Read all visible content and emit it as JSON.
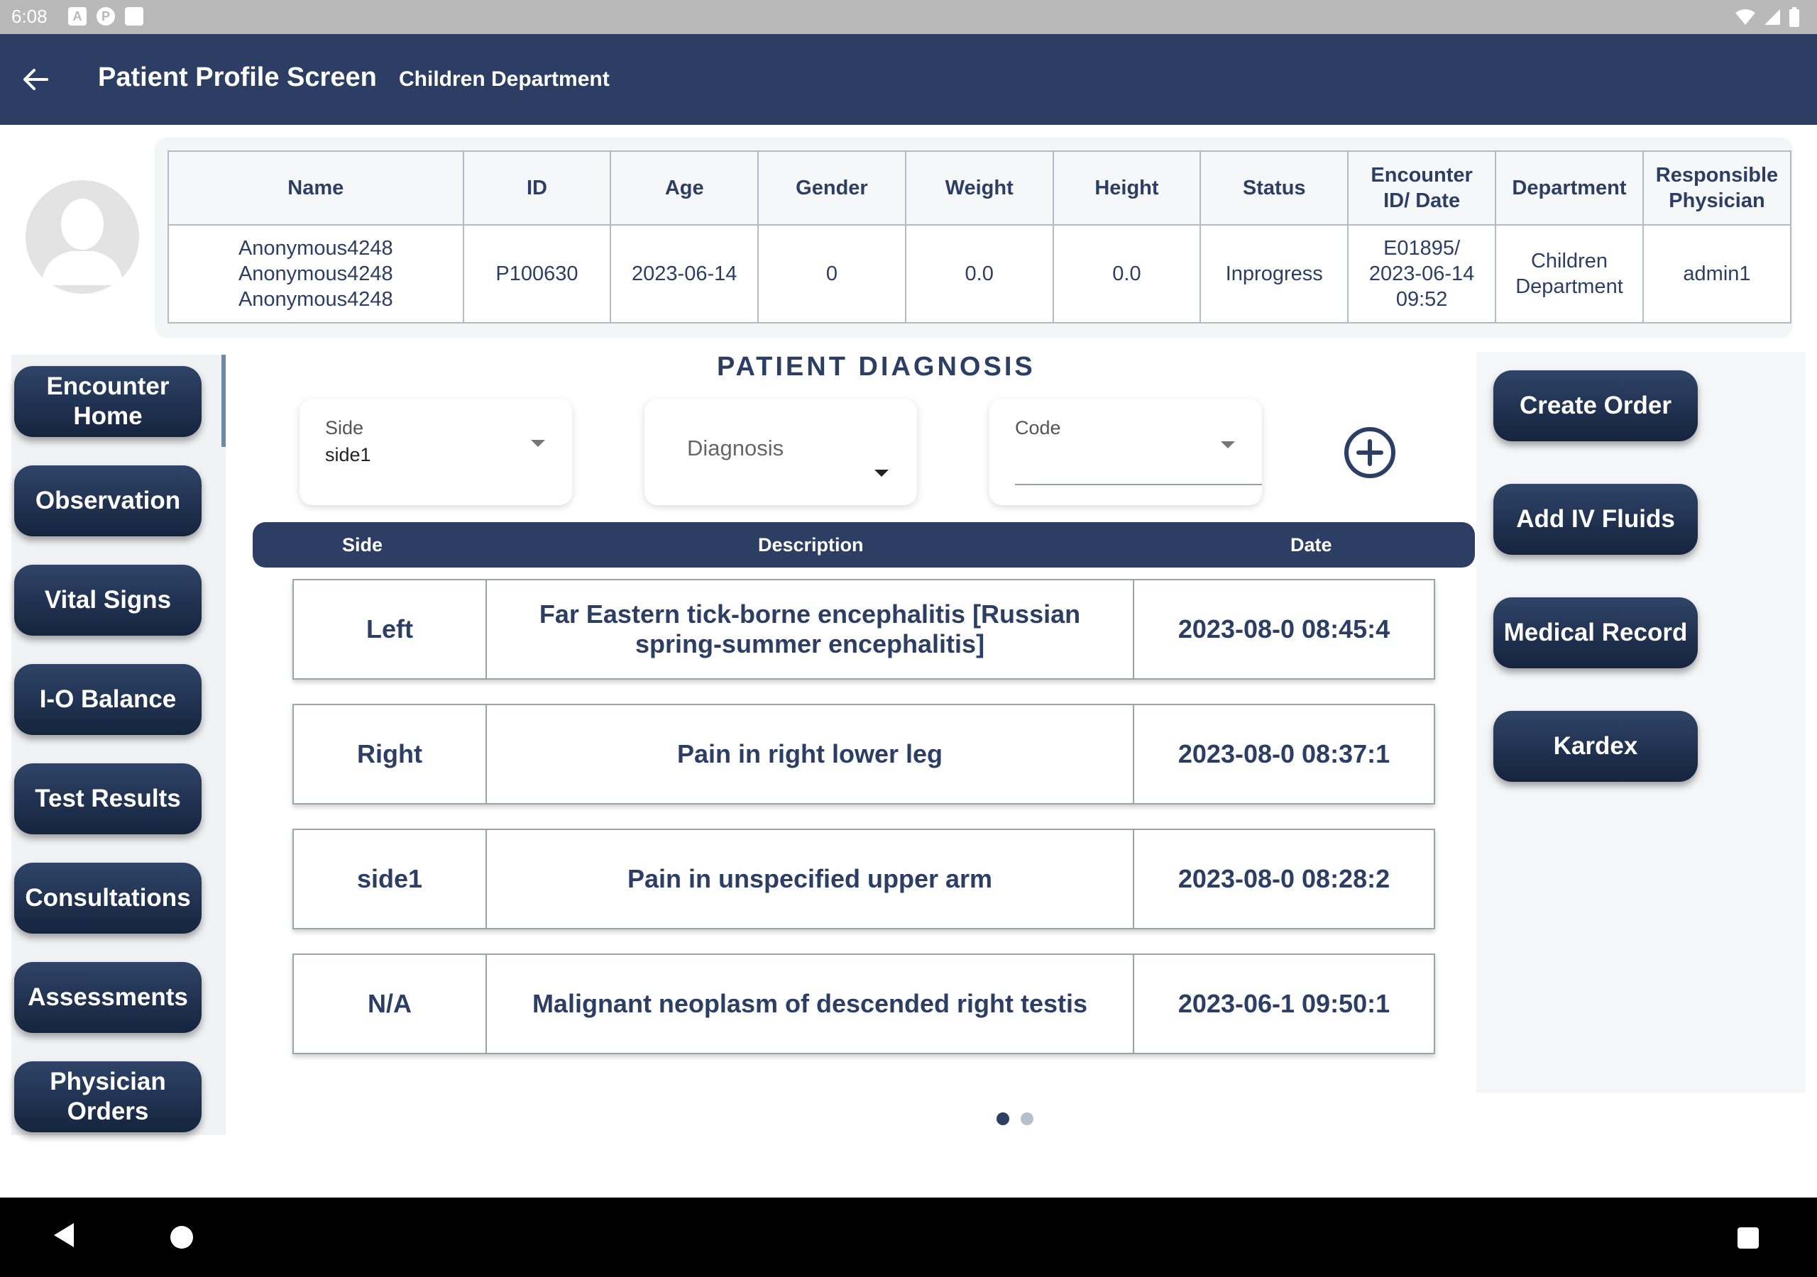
{
  "status_bar": {
    "time": "6:08",
    "icons": [
      "a-icon",
      "p-icon",
      "sd-card-icon"
    ],
    "right_icons": [
      "wifi-icon",
      "signal-icon",
      "battery-icon"
    ]
  },
  "app_bar": {
    "back_icon": "arrow-back-icon",
    "title": "Patient Profile Screen",
    "subtitle": "Children Department"
  },
  "patient_info": {
    "headers": [
      "Name",
      "ID",
      "Age",
      "Gender",
      "Weight",
      "Height",
      "Status",
      "Encounter ID/ Date",
      "Department",
      "Responsible Physician"
    ],
    "values": {
      "name": [
        "Anonymous4248",
        "Anonymous4248",
        "Anonymous4248"
      ],
      "id": "P100630",
      "age": "2023-06-14",
      "gender": "0",
      "weight": "0.0",
      "height": "0.0",
      "status": "Inprogress",
      "encounter": [
        "E01895/",
        "2023-06-14",
        "09:52"
      ],
      "department": [
        "Children",
        "Department"
      ],
      "physician": "admin1"
    }
  },
  "left_nav": {
    "items": [
      {
        "label": "Encounter Home",
        "active": true
      },
      {
        "label": "Observation"
      },
      {
        "label": "Vital Signs"
      },
      {
        "label": "I-O Balance"
      },
      {
        "label": "Test Results"
      },
      {
        "label": "Consultations"
      },
      {
        "label": "Assessments"
      },
      {
        "label": "Physician Orders"
      }
    ]
  },
  "diagnosis": {
    "title": "PATIENT DIAGNOSIS",
    "side_field": {
      "label": "Side",
      "value": "side1"
    },
    "diagnosis_field": {
      "placeholder": "Diagnosis"
    },
    "code_field": {
      "label": "Code",
      "value": ""
    },
    "add_icon": "plus-circle-icon",
    "columns": [
      "Side",
      "Description",
      "Date"
    ],
    "rows": [
      {
        "side": "Left",
        "description": "Far Eastern tick-borne encephalitis [Russian spring-summer encephalitis]",
        "date": "2023-08-0 08:45:4"
      },
      {
        "side": "Right",
        "description": "Pain in right lower leg",
        "date": "2023-08-0 08:37:1"
      },
      {
        "side": "side1",
        "description": "Pain in unspecified upper arm",
        "date": "2023-08-0 08:28:2"
      },
      {
        "side": "N/A",
        "description": "Malignant neoplasm of descended right testis",
        "date": "2023-06-1 09:50:1"
      }
    ],
    "page_indicator": {
      "pages": 2,
      "current": 1
    }
  },
  "right_actions": {
    "create_order": "Create Order",
    "add_iv_fluids": "Add IV Fluids",
    "medical_record": "Medical Record",
    "kardex": "Kardex"
  },
  "colors": {
    "primary": "#2c3e64",
    "button_dark": "#15243e",
    "status_bar": "#b9b9b9"
  }
}
